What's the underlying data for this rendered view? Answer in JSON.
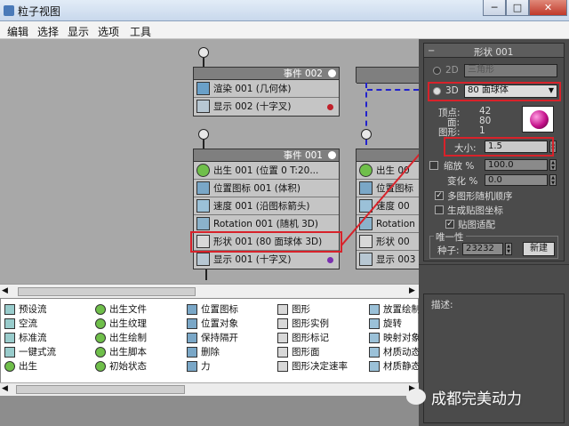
{
  "window": {
    "title": "粒子视图",
    "minimize": "─",
    "maximize": "□",
    "close": "✕"
  },
  "menu": [
    "编辑",
    "选择",
    "显示",
    "选项",
    "工具"
  ],
  "events": [
    {
      "id": "event-002",
      "title": "事件 002",
      "rows": [
        {
          "icon": "render-icon",
          "label": "渲染 001 (几何体)"
        },
        {
          "icon": "display-icon",
          "label": "显示 002 (十字叉)",
          "dot": "#c0202a"
        }
      ]
    },
    {
      "id": "event-001",
      "title": "事件 001",
      "rows": [
        {
          "icon": "birth-icon",
          "label": "出生 001 (位置 0 T:20..."
        },
        {
          "icon": "position-icon",
          "label": "位置图标 001 (体积)"
        },
        {
          "icon": "speed-icon",
          "label": "速度 001 (沿图标箭头)"
        },
        {
          "icon": "rotation-icon",
          "label": "Rotation 001 (随机 3D)"
        },
        {
          "icon": "shape-icon",
          "label": "形状 001 (80 面球体 3D)"
        },
        {
          "icon": "display-icon",
          "label": "显示 001 (十字叉)",
          "dot": "#7a2fb0"
        }
      ]
    },
    {
      "id": "event-partial",
      "title": "",
      "rows": [
        {
          "label": "出生 00"
        },
        {
          "label": "位置图标"
        },
        {
          "label": "速度 00"
        },
        {
          "label": "Rotation"
        },
        {
          "label": "形状 00"
        },
        {
          "label": "显示 003"
        }
      ]
    }
  ],
  "depot": [
    [
      "预设流",
      "空流",
      "标准流",
      "一键式流",
      "出生"
    ],
    [
      "出生文件",
      "出生纹理",
      "出生绘制",
      "出生脚本",
      "初始状态"
    ],
    [
      "位置图标",
      "位置对象",
      "保持隔开",
      "删除",
      "力"
    ],
    [
      "图形",
      "图形实例",
      "图形标记",
      "图形面",
      "图形决定速率"
    ],
    [
      "放置绘制",
      "旋转",
      "映射对象",
      "材质动态",
      "材质静态"
    ]
  ],
  "panel": {
    "title": "形状 001",
    "mode2d": "2D",
    "shape2d": "三角形",
    "mode3d": "3D",
    "shape3d": "80 面球体",
    "vertices_label": "顶点:",
    "vertices": "42",
    "faces_label": "面:",
    "faces": "80",
    "shapes_label": "图形:",
    "shapes": "1",
    "size_label": "大小:",
    "size": "1.5",
    "scale_label": "缩放 %",
    "scale": "100.0",
    "variation_label": "变化 %",
    "variation": "0.0",
    "multi_random": "多图形随机顺序",
    "gen_mapping": "生成贴图坐标",
    "map_fit": "贴图适配",
    "unique_group": "唯一性",
    "seed_label": "种子:",
    "seed": "23232",
    "new_button": "新建",
    "desc_label": "描述:"
  },
  "watermark": "成都完美动力",
  "colors": {
    "highlight": "#d8222a",
    "accent_line": "#2222cc",
    "preview_sphere": "#c4108a"
  }
}
